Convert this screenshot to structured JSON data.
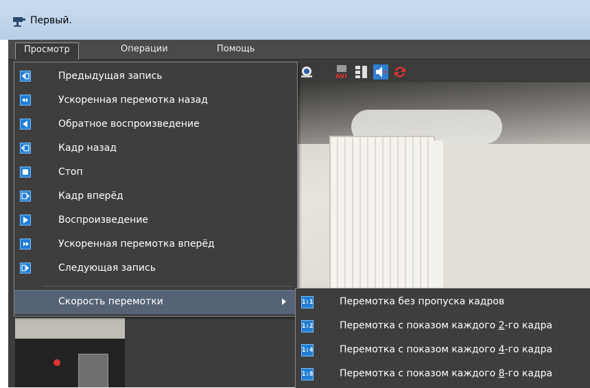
{
  "window": {
    "title": "Первый."
  },
  "menubar": {
    "items": [
      "Просмотр",
      "Операции",
      "Помощь"
    ]
  },
  "view_menu": {
    "items": [
      {
        "label": "Предыдущая запись",
        "icon": "previous-record-icon"
      },
      {
        "label": "Ускоренная перемотка назад",
        "icon": "fast-rewind-icon"
      },
      {
        "label": "Обратное воспроизведение",
        "icon": "reverse-play-icon"
      },
      {
        "label": "Кадр назад",
        "icon": "frame-back-icon"
      },
      {
        "label": "Стоп",
        "icon": "stop-icon"
      },
      {
        "label": "Кадр вперёд",
        "icon": "frame-forward-icon"
      },
      {
        "label": "Воспроизведение",
        "icon": "play-icon"
      },
      {
        "label": "Ускоренная перемотка вперёд",
        "icon": "fast-forward-icon"
      },
      {
        "label": "Следующая запись",
        "icon": "next-record-icon"
      }
    ],
    "speed_item": "Скорость перемотки"
  },
  "speed_submenu": {
    "items": [
      {
        "badge": "1:1",
        "label": "Перемотка без пропуска кадров",
        "pre": "",
        "u": "",
        "post": ""
      },
      {
        "badge": "1:2",
        "label": "",
        "pre": "Перемотка с показом каждого ",
        "u": "2",
        "post": "-го кадра"
      },
      {
        "badge": "1:4",
        "label": "",
        "pre": "Перемотка с показом каждого ",
        "u": "4",
        "post": "-го кадра"
      },
      {
        "badge": "1:8",
        "label": "",
        "pre": "Перемотка с показом каждого ",
        "u": "8",
        "post": "-го кадра"
      }
    ]
  },
  "toolbar": {
    "icons": [
      "snapshot-icon",
      "export-avi-icon",
      "layout-icon",
      "sound-icon",
      "sync-icon"
    ],
    "avi_text": "AVI"
  },
  "colors": {
    "menu_bg": "#3e3e3e",
    "highlight": "#566275",
    "icon_blue": "#1f7fd6"
  }
}
